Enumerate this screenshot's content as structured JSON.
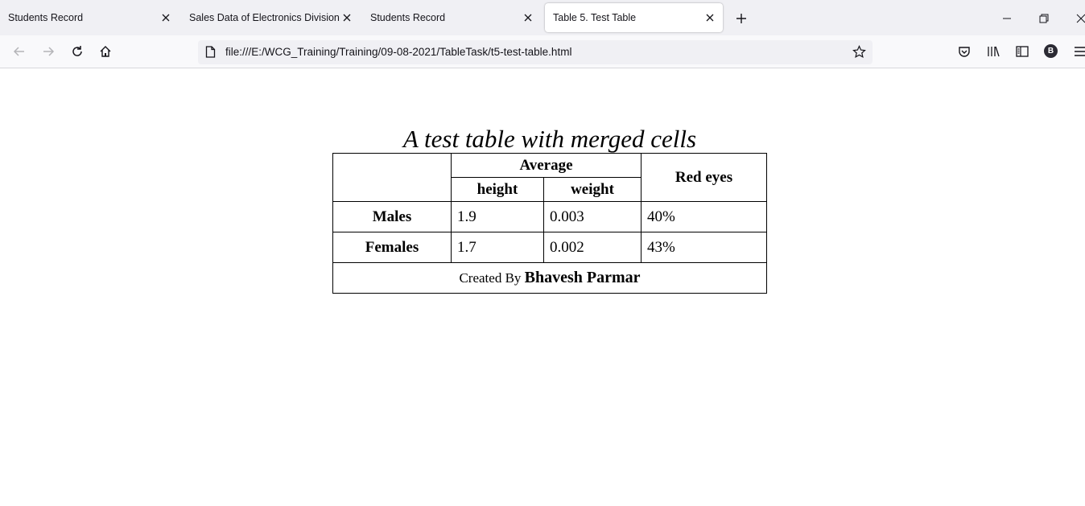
{
  "browser": {
    "tabs": [
      {
        "label": "Students Record",
        "active": false
      },
      {
        "label": "Sales Data of Electronics Division",
        "active": false
      },
      {
        "label": "Students Record",
        "active": false
      },
      {
        "label": "Table 5. Test Table",
        "active": true
      }
    ],
    "url": "file:///E:/WCG_Training/Training/09-08-2021/TableTask/t5-test-table.html",
    "account_initial": "B"
  },
  "page": {
    "caption": "A test table with merged cells",
    "headers": {
      "average": "Average",
      "red_eyes": "Red eyes",
      "height": "height",
      "weight": "weight"
    },
    "rows": [
      {
        "label": "Males",
        "height": "1.9",
        "weight": "0.003",
        "red_eyes": "40%"
      },
      {
        "label": "Females",
        "height": "1.7",
        "weight": "0.002",
        "red_eyes": "43%"
      }
    ],
    "footer": {
      "prefix": "Created By",
      "name": "Bhavesh Parmar"
    }
  }
}
